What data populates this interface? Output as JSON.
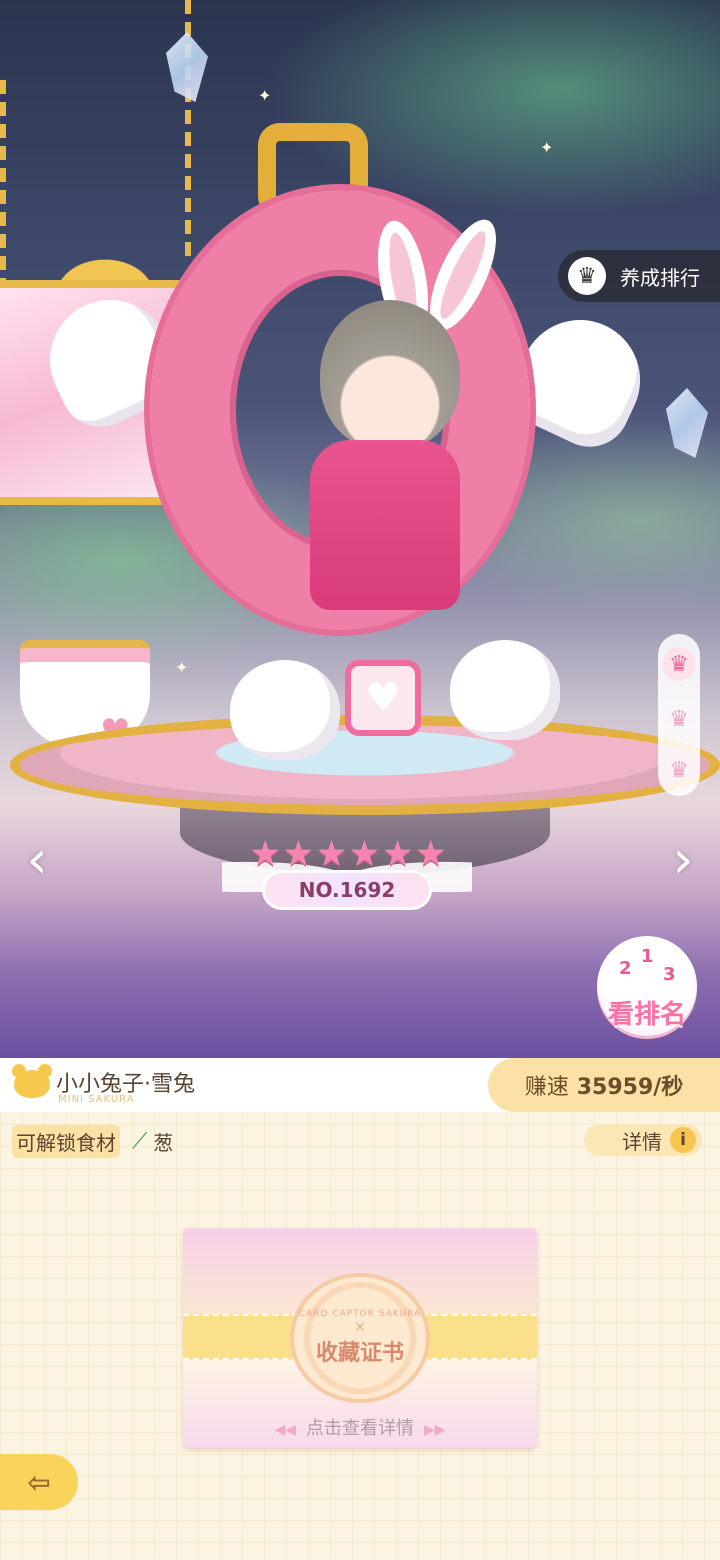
{
  "rank_button": {
    "label": "养成排行",
    "icon": "trophy-icon"
  },
  "badge": {
    "number": "NO.1692",
    "stars": 6
  },
  "see_ranking": {
    "label": "看排名",
    "podium": [
      "2",
      "1",
      "3"
    ]
  },
  "character": {
    "name": "小小兔子·雪兔",
    "subtitle": "MINI SAKURA"
  },
  "speed": {
    "label": "赚速",
    "value": "35959/秒"
  },
  "ingredient": {
    "label": "可解锁食材",
    "item": "葱",
    "icon": "leek-icon"
  },
  "detail": {
    "label": "详情",
    "icon": "info-icon"
  },
  "certificate": {
    "seal_top": "CARD CAPTOR SAKURA",
    "seal_x": "×",
    "title": "收藏证书",
    "hint": "点击查看详情"
  },
  "colors": {
    "accent_pink": "#f07fa7",
    "gold": "#e4ae3a",
    "panel_bg": "#fcf4e3",
    "speed_pill": "#fbe1a5"
  }
}
